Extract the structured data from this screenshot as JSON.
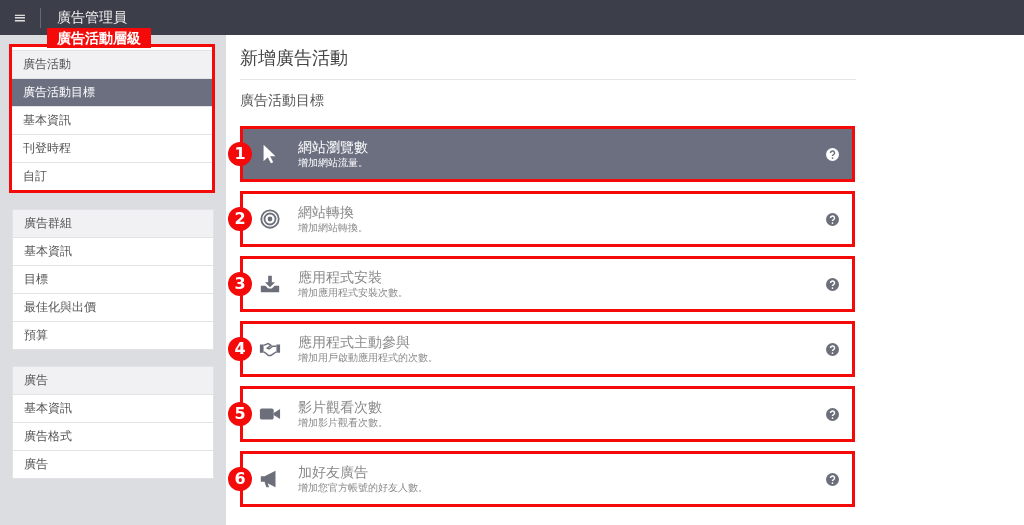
{
  "topbar": {
    "menu_icon": "≡",
    "title": "廣告管理員"
  },
  "sidebar": {
    "annotation_label": "廣告活動層級",
    "groups": [
      {
        "items": [
          {
            "label": "廣告活動",
            "kind": "header",
            "selected": false
          },
          {
            "label": "廣告活動目標",
            "kind": "item",
            "selected": true
          },
          {
            "label": "基本資訊",
            "kind": "item",
            "selected": false
          },
          {
            "label": "刊登時程",
            "kind": "item",
            "selected": false
          },
          {
            "label": "自訂",
            "kind": "item",
            "selected": false
          }
        ],
        "annotated": true
      },
      {
        "items": [
          {
            "label": "廣告群組",
            "kind": "header",
            "selected": false
          },
          {
            "label": "基本資訊",
            "kind": "item",
            "selected": false
          },
          {
            "label": "目標",
            "kind": "item",
            "selected": false
          },
          {
            "label": "最佳化與出價",
            "kind": "item",
            "selected": false
          },
          {
            "label": "預算",
            "kind": "item",
            "selected": false
          }
        ],
        "annotated": false
      },
      {
        "items": [
          {
            "label": "廣告",
            "kind": "header",
            "selected": false
          },
          {
            "label": "基本資訊",
            "kind": "item",
            "selected": false
          },
          {
            "label": "廣告格式",
            "kind": "item",
            "selected": false
          },
          {
            "label": "廣告",
            "kind": "item",
            "selected": false
          }
        ],
        "annotated": false
      }
    ]
  },
  "main": {
    "title": "新增廣告活動",
    "section_title": "廣告活動目標",
    "objectives": [
      {
        "number": "1",
        "kind": "pointer",
        "title": "網站瀏覽數",
        "description": "增加網站流量。",
        "selected": true
      },
      {
        "number": "2",
        "kind": "target",
        "title": "網站轉換",
        "description": "增加網站轉換。",
        "selected": false
      },
      {
        "number": "3",
        "kind": "download",
        "title": "應用程式安裝",
        "description": "增加應用程式安裝次數。",
        "selected": false
      },
      {
        "number": "4",
        "kind": "handshake",
        "title": "應用程式主動參與",
        "description": "增加用戶啟動應用程式的次數。",
        "selected": false
      },
      {
        "number": "5",
        "kind": "video",
        "title": "影片觀看次數",
        "description": "增加影片觀看次數。",
        "selected": false
      },
      {
        "number": "6",
        "kind": "megaphone",
        "title": "加好友廣告",
        "description": "增加您官方帳號的好友人數。",
        "selected": false
      }
    ]
  }
}
